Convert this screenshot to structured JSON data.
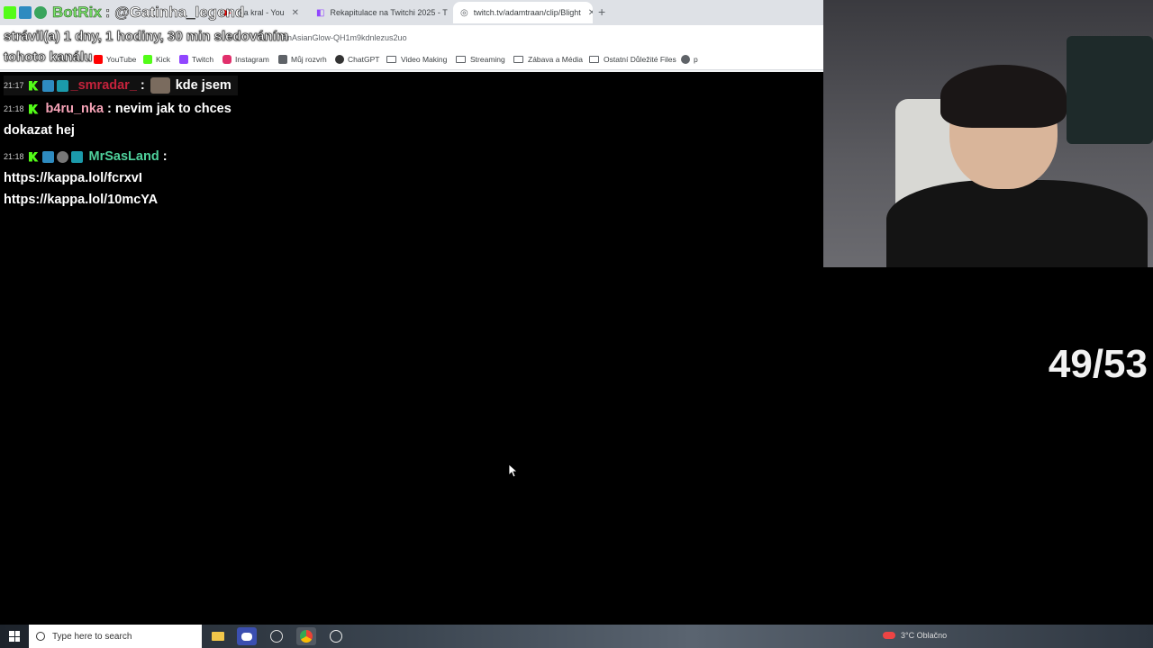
{
  "browser": {
    "tabs": [
      {
        "label": "rka kral - You",
        "active": false
      },
      {
        "label": "Rekapitulace na Twitchi 2025 - T",
        "active": false
      },
      {
        "label": "twitch.tv/adamtraan/clip/Blight",
        "active": true
      }
    ],
    "new_tab": "+",
    "url_fragment": "anAsianGlow-QH1m9kdnlezus2uo",
    "bookmarks": [
      {
        "label": "YouTube",
        "icon": "youtube-icon",
        "color": "#ff0000"
      },
      {
        "label": "Kick",
        "icon": "kick-icon",
        "color": "#53fc18"
      },
      {
        "label": "Twitch",
        "icon": "twitch-icon",
        "color": "#9146ff"
      },
      {
        "label": "Instagram",
        "icon": "instagram-icon",
        "color": "#e1306c"
      },
      {
        "label": "Můj rozvrh",
        "icon": "schedule-icon",
        "color": "#5f6368"
      },
      {
        "label": "ChatGPT",
        "icon": "chatgpt-icon",
        "color": "#333333"
      },
      {
        "label": "Video Making",
        "icon": "folder-icon",
        "color": "#5f6368"
      },
      {
        "label": "Streaming",
        "icon": "folder-icon",
        "color": "#5f6368"
      },
      {
        "label": "Zábava a Média",
        "icon": "folder-icon",
        "color": "#5f6368"
      },
      {
        "label": "Ostatní Důležité Files",
        "icon": "folder-icon",
        "color": "#5f6368"
      },
      {
        "label": "p",
        "icon": "globe-icon",
        "color": "#5f6368"
      }
    ]
  },
  "overlay": {
    "bot_name": "BotRix",
    "bot_text": ": @Gatinha_legend",
    "line2": "strávil(a) 1 dny, 1 hodiny, 30 min sledováním",
    "line3": "tohoto kanálu"
  },
  "chat": [
    {
      "time": "21:17",
      "user": "_smradar_",
      "sep": ":",
      "message": "kde jsem"
    },
    {
      "time": "21:18",
      "user": "b4ru_nka",
      "sep": ":",
      "message": "nevim jak to chces",
      "message_cont": "dokazat hej"
    },
    {
      "time": "21:18",
      "user": "MrSasLand",
      "sep": ":",
      "links": [
        "https://kappa.lol/fcrxvI",
        "https://kappa.lol/10mcYA"
      ]
    }
  ],
  "counter": "49/53",
  "taskbar": {
    "search_placeholder": "Type here to search",
    "weather": "3°C Oblačno"
  },
  "colors": {
    "kick_green": "#53fc18",
    "smradar": "#c5223b",
    "b4ru": "#f6a3b7",
    "mrsas": "#4fd19c",
    "botrix": "#7ae36a"
  }
}
